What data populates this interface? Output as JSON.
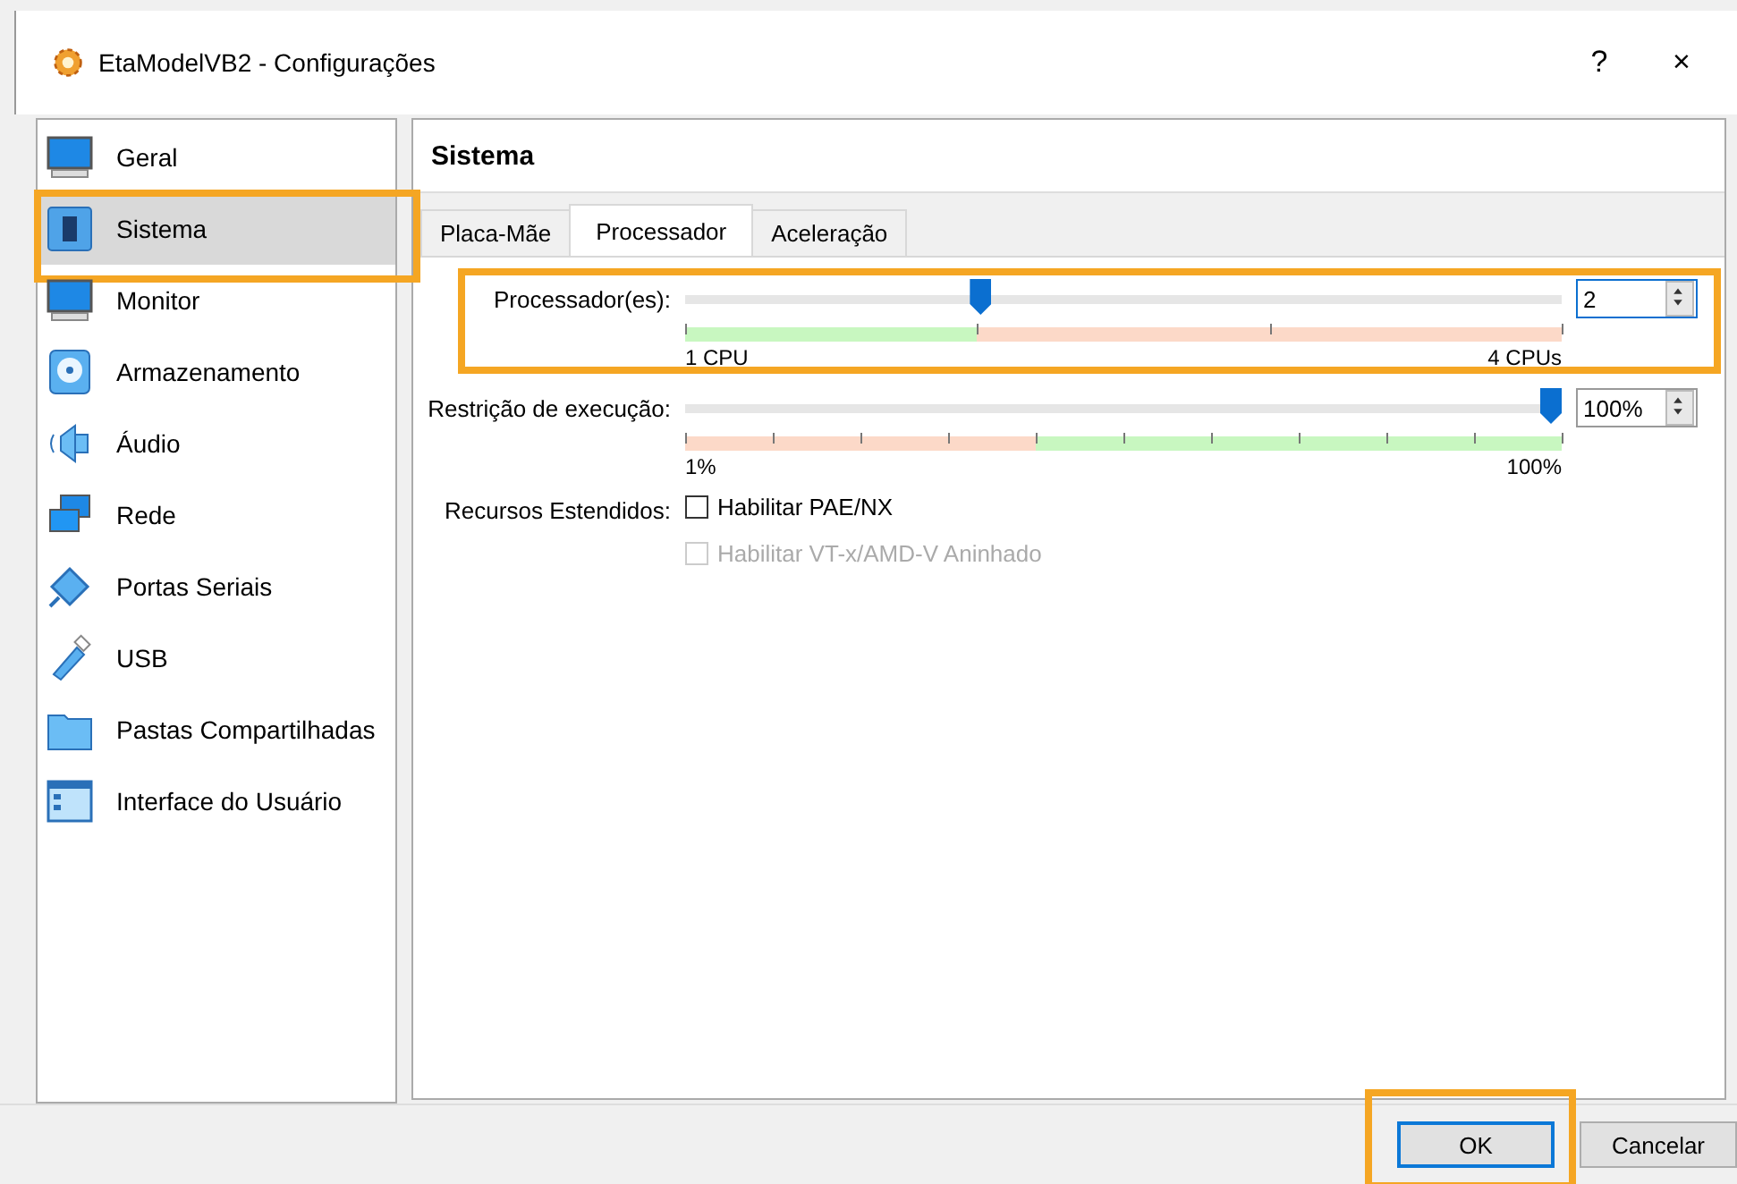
{
  "window": {
    "title": "EtaModelVB2 - Configurações",
    "buttons": [
      "?",
      "×"
    ]
  },
  "sidebar": {
    "items": [
      {
        "label": "Geral",
        "selected": false
      },
      {
        "label": "Sistema",
        "selected": true,
        "highlighted": true
      },
      {
        "label": "Monitor",
        "selected": false
      },
      {
        "label": "Armazenamento",
        "selected": false
      },
      {
        "label": "Áudio",
        "selected": false
      },
      {
        "label": "Rede",
        "selected": false
      },
      {
        "label": "Portas Seriais",
        "selected": false
      },
      {
        "label": "USB",
        "selected": false
      },
      {
        "label": "Pastas Compartilhadas",
        "selected": false
      },
      {
        "label": "Interface do Usuário",
        "selected": false
      }
    ]
  },
  "page": {
    "title": "Sistema",
    "tabs": [
      {
        "label": "Placa-Mãe",
        "selected": false
      },
      {
        "label": "Processador",
        "selected": true
      },
      {
        "label": "Aceleração",
        "selected": false
      }
    ],
    "sliders": [
      {
        "kind": "cpu",
        "label": "Processador(es):",
        "level": 0.333,
        "value": "2",
        "min_label": "1 CPU",
        "max_label": "4 CPUs",
        "highlighted": true
      },
      {
        "kind": "cap",
        "label": "Restrição de execução:",
        "level": 1,
        "value": "100%",
        "min_label": "1%",
        "max_label": "100%"
      }
    ],
    "extended": {
      "label": "Recursos Estendidos:",
      "options": [
        {
          "label": "Habilitar PAE/NX",
          "checked": false,
          "disabled": false
        },
        {
          "label": "Habilitar VT-x/AMD-V Aninhado",
          "checked": false,
          "disabled": true
        }
      ]
    }
  },
  "buttons": [
    {
      "label": "OK",
      "default": true,
      "highlighted": true
    },
    {
      "label": "Cancelar",
      "default": false
    }
  ]
}
